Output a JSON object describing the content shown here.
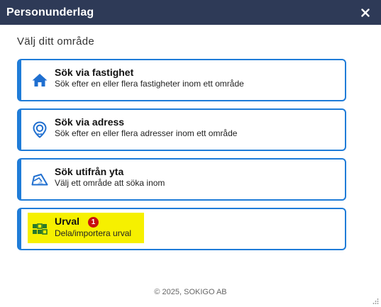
{
  "window": {
    "title": "Personunderlag",
    "close_label": "×"
  },
  "heading": "Välj ditt område",
  "options": [
    {
      "label": "Sök via fastighet",
      "description": "Sök efter en eller flera fastigheter inom ett område",
      "icon": "home-icon"
    },
    {
      "label": "Sök via adress",
      "description": "Sök efter en eller flera adresser inom ett område",
      "icon": "location-pin-icon"
    },
    {
      "label": "Sök utifrån yta",
      "description": "Välj ett område att söka inom",
      "icon": "area-select-icon"
    },
    {
      "label": "Urval",
      "description": "Dela/importera urval",
      "icon": "selection-grid-icon",
      "badge": "1",
      "highlighted": true
    }
  ],
  "footer": "© 2025, SOKIGO AB",
  "colors": {
    "titlebar": "#2e3a57",
    "accent": "#1f7cd8",
    "highlight": "#f6f000",
    "badge": "#c81010"
  }
}
